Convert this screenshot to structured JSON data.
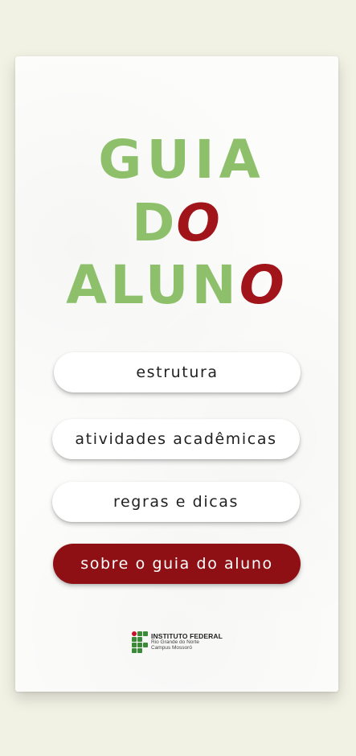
{
  "title": {
    "line1": "GUIA",
    "line2_part1": "D",
    "line2_accent": "O",
    "line3_part1": "ALUN",
    "line3_accent": "O"
  },
  "menu": {
    "items": [
      {
        "label": "estrutura"
      },
      {
        "label": "atividades acadêmicas"
      },
      {
        "label": "regras e dicas"
      },
      {
        "label": "sobre o guia do aluno"
      }
    ]
  },
  "footer": {
    "institution": "INSTITUTO FEDERAL",
    "state": "Rio Grande do Norte",
    "campus": "Campus Mossoró"
  },
  "colors": {
    "background": "#f1f1e4",
    "title_green": "#8ec06c",
    "accent_red": "#a0141a",
    "primary_button": "#8f1014"
  }
}
